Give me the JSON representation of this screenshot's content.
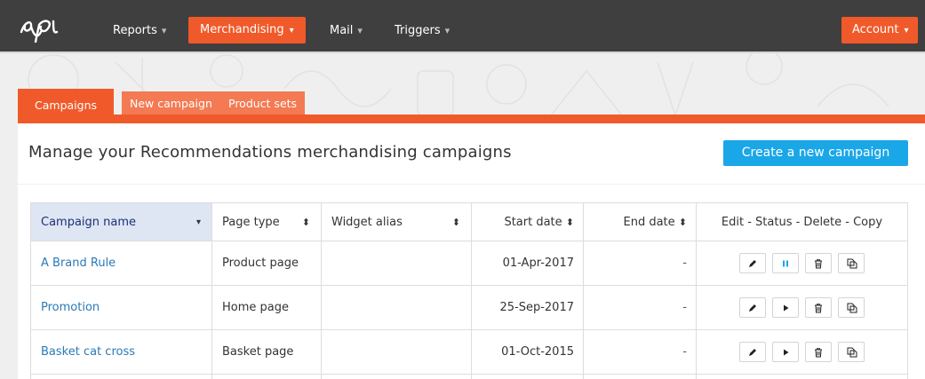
{
  "nav": {
    "logo_text": "epi",
    "items": [
      {
        "label": "Reports",
        "caret": "▾"
      },
      {
        "label": "Merchandising",
        "caret": "▾"
      },
      {
        "label": "Mail",
        "caret": "▾"
      },
      {
        "label": "Triggers",
        "caret": "▾"
      }
    ],
    "account": {
      "label": "Account",
      "caret": "▾"
    },
    "colors": {
      "bar": "#3f3f3f",
      "accent": "#f05a2a"
    }
  },
  "tabs": [
    {
      "label": "Campaigns",
      "active": true
    },
    {
      "label": "New campaign",
      "active": false
    },
    {
      "label": "Product sets",
      "active": false
    }
  ],
  "panel": {
    "title": "Manage your Recommendations merchandising campaigns",
    "create_button": "Create a new campaign"
  },
  "table": {
    "columns": [
      {
        "label": "Campaign name",
        "sort": "▾"
      },
      {
        "label": "Page type",
        "sort": "⬍"
      },
      {
        "label": "Widget alias",
        "sort": "⬍"
      },
      {
        "label": "Start date",
        "sort": "⬍"
      },
      {
        "label": "End date",
        "sort": "⬍"
      },
      {
        "label": "Edit - Status - Delete - Copy"
      }
    ],
    "rows": [
      {
        "name": "A Brand Rule",
        "page_type": "Product page",
        "widget_alias": "",
        "start_date": "01-Apr-2017",
        "end_date": "-",
        "status_icon": "pause-icon"
      },
      {
        "name": "Promotion",
        "page_type": "Home page",
        "widget_alias": "",
        "start_date": "25-Sep-2017",
        "end_date": "-",
        "status_icon": "play-icon"
      },
      {
        "name": "Basket cat cross",
        "page_type": "Basket page",
        "widget_alias": "",
        "start_date": "01-Oct-2015",
        "end_date": "-",
        "status_icon": "play-icon"
      }
    ]
  }
}
